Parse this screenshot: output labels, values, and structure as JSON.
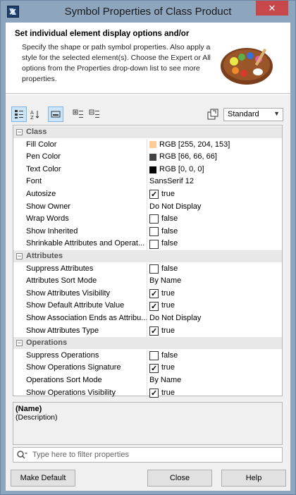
{
  "window": {
    "title": "Symbol Properties of Class Product"
  },
  "header": {
    "title": "Set individual element display options and/or",
    "description": "Specify the shape or path symbol properties. Also apply a style for the selected element(s). Choose the Expert or All options from the Properties drop-down list to see more properties."
  },
  "toolbar": {
    "mode_selected": "Standard"
  },
  "categories": [
    {
      "label": "Class",
      "rows": [
        {
          "name": "Fill Color",
          "value": "RGB [255, 204, 153]",
          "swatch": "#ffcc99"
        },
        {
          "name": "Pen Color",
          "value": "RGB [66, 66, 66]",
          "swatch": "#424242"
        },
        {
          "name": "Text Color",
          "value": "RGB [0, 0, 0]",
          "swatch": "#000000"
        },
        {
          "name": "Font",
          "value": "SansSerif 12"
        },
        {
          "name": "Autosize",
          "value": "true",
          "check": true
        },
        {
          "name": "Show Owner",
          "value": "Do Not Display"
        },
        {
          "name": "Wrap Words",
          "value": "false",
          "check": false
        },
        {
          "name": "Show Inherited",
          "value": "false",
          "check": false
        },
        {
          "name": "Shrinkable Attributes and Operat...",
          "value": "false",
          "check": false
        }
      ]
    },
    {
      "label": "Attributes",
      "rows": [
        {
          "name": "Suppress Attributes",
          "value": "false",
          "check": false
        },
        {
          "name": "Attributes Sort Mode",
          "value": "By Name"
        },
        {
          "name": "Show Attributes Visibility",
          "value": "true",
          "check": true
        },
        {
          "name": "Show Default Attribute Value",
          "value": "true",
          "check": true
        },
        {
          "name": "Show Association Ends as Attribu...",
          "value": "Do Not Display"
        },
        {
          "name": "Show Attributes Type",
          "value": "true",
          "check": true
        }
      ]
    },
    {
      "label": "Operations",
      "rows": [
        {
          "name": "Suppress Operations",
          "value": "false",
          "check": false
        },
        {
          "name": "Show Operations Signature",
          "value": "true",
          "check": true
        },
        {
          "name": "Operations Sort Mode",
          "value": "By Name"
        },
        {
          "name": "Show Operations Visibility",
          "value": "true",
          "check": true
        }
      ]
    }
  ],
  "description_box": {
    "name": "(Name)",
    "text": "(Description)"
  },
  "filter": {
    "placeholder": "Type here to filter properties"
  },
  "buttons": {
    "make_default": "Make Default",
    "close": "Close",
    "help": "Help"
  }
}
